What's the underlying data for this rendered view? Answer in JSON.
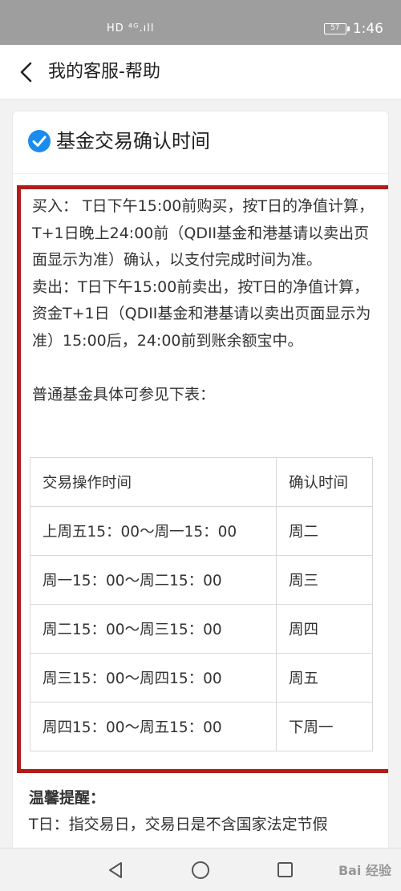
{
  "status_bar": {
    "network": "HD ⁴ᴳ.ıll",
    "battery": "57",
    "time": "1:46"
  },
  "nav": {
    "title": "我的客服-帮助"
  },
  "card": {
    "title": "基金交易确认时间",
    "buy_text": "买入： T日下午15:00前购买，按T日的净值计算， T+1日晚上24:00前（QDII基金和港基请以卖出页面显示为准）确认，以支付完成时间为准。",
    "sell_text": "卖出：T日下午15:00前卖出，按T日的净值计算，资金T+1日（QDII基金和港基请以卖出页面显示为准）15:00后，24:00前到账余额宝中。",
    "table_intro": "普通基金具体可参见下表：",
    "table": {
      "headers": [
        "交易操作时间",
        "确认时间"
      ],
      "rows": [
        [
          "上周五15：00～周一15：00",
          "周二"
        ],
        [
          "周一15：00～周二15：00",
          "周三"
        ],
        [
          "周二15：00～周三15：00",
          "周四"
        ],
        [
          "周三15：00～周四15：00",
          "周五"
        ],
        [
          "周四15：00～周五15：00",
          "下周一"
        ]
      ]
    },
    "tips_title": "温馨提醒：",
    "tips_text": "T日：指交易日，交易日是不含国家法定节假"
  },
  "watermark": "Bai 经验",
  "colors": {
    "highlight_border": "#b31b1b",
    "check_blue": "#1a8cf0",
    "status_bar_bg": "#9e9e9e"
  }
}
